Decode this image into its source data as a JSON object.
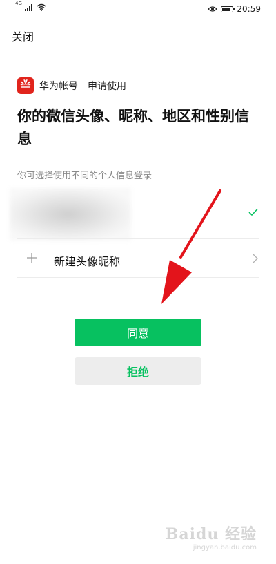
{
  "status_bar": {
    "network_label": "4G",
    "time": "20:59",
    "icons": [
      "signal-icon",
      "wifi-icon",
      "eye-icon",
      "battery-icon"
    ]
  },
  "header": {
    "close_label": "关闭"
  },
  "app": {
    "name": "华为帐号",
    "action": "申请使用",
    "logo_icon": "huawei-logo-icon",
    "brand_color": "#e1241c"
  },
  "title": "你的微信头像、昵称、地区和性别信息",
  "subtitle": "你可选择使用不同的个人信息登录",
  "profiles": {
    "current": {
      "selected": true,
      "check_icon": "check-icon"
    },
    "new_profile": {
      "label": "新建头像昵称",
      "plus_icon": "plus-icon",
      "chevron_icon": "chevron-right-icon"
    }
  },
  "buttons": {
    "agree_label": "同意",
    "reject_label": "拒绝",
    "accent_color": "#07c160"
  },
  "annotation": {
    "color": "#e3141b"
  },
  "watermark": {
    "main": "Baidu 经验",
    "sub": "jingyan.baidu.com"
  }
}
